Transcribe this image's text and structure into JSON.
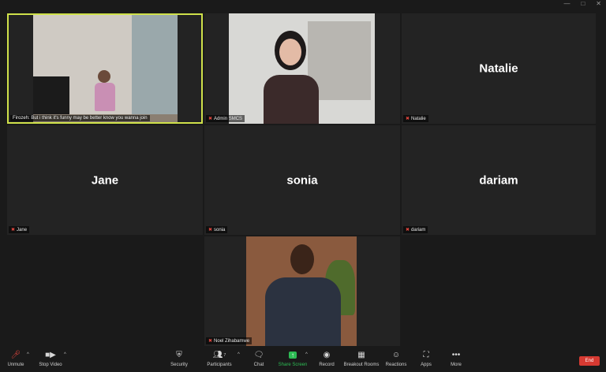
{
  "participants": [
    {
      "name": "Firozeh",
      "caption": "Firozeh: But i think it's funny may be better know you wanna join",
      "muted": false,
      "video": true
    },
    {
      "name": "Admin SMCS",
      "muted": true,
      "video": true
    },
    {
      "name": "Natalie",
      "muted": true,
      "video": false
    },
    {
      "name": "Jane",
      "muted": true,
      "video": false
    },
    {
      "name": "sonia",
      "muted": true,
      "video": false
    },
    {
      "name": "dariam",
      "muted": true,
      "video": false
    },
    {
      "name": "Noel Zihabamwe",
      "muted": true,
      "video": true
    }
  ],
  "toolbar": {
    "unmute": "Unmute",
    "stop_video": "Stop Video",
    "security": "Security",
    "participants": "Participants",
    "participants_count": "7",
    "chat": "Chat",
    "share_screen": "Share Screen",
    "record": "Record",
    "breakout_rooms": "Breakout Rooms",
    "reactions": "Reactions",
    "apps": "Apps",
    "more": "More",
    "end": "End"
  },
  "colors": {
    "active_speaker": "#cfe14a",
    "share_green": "#2dbb54",
    "end_red": "#d63a32"
  }
}
